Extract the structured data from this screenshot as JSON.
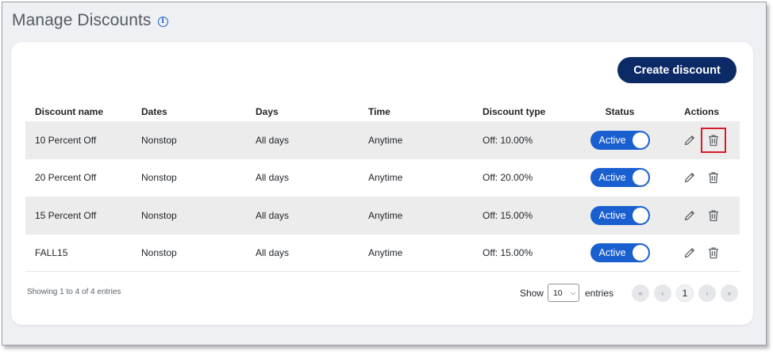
{
  "page": {
    "title": "Manage Discounts",
    "info_icon": "i"
  },
  "toolbar": {
    "create_label": "Create discount"
  },
  "table": {
    "headers": {
      "name": "Discount name",
      "dates": "Dates",
      "days": "Days",
      "time": "Time",
      "type": "Discount type",
      "status": "Status",
      "actions": "Actions"
    },
    "rows": [
      {
        "name": "10 Percent Off",
        "dates": "Nonstop",
        "days": "All days",
        "time": "Anytime",
        "type": "Off: 10.00%",
        "status": "Active"
      },
      {
        "name": "20 Percent Off",
        "dates": "Nonstop",
        "days": "All days",
        "time": "Anytime",
        "type": "Off: 20.00%",
        "status": "Active"
      },
      {
        "name": "15 Percent Off",
        "dates": "Nonstop",
        "days": "All days",
        "time": "Anytime",
        "type": "Off: 15.00%",
        "status": "Active"
      },
      {
        "name": "FALL15",
        "dates": "Nonstop",
        "days": "All days",
        "time": "Anytime",
        "type": "Off: 15.00%",
        "status": "Active"
      }
    ]
  },
  "footer": {
    "info": "Showing 1 to 4 of 4 entries",
    "show_label": "Show",
    "page_size": "10",
    "entries_label": "entries",
    "first": "«",
    "prev": "‹",
    "current_page": "1",
    "next": "›",
    "last": "»"
  },
  "colors": {
    "accent": "#0c2a66",
    "toggle": "#1a5fd0",
    "highlight": "#d41e2a"
  },
  "icons": [
    "info-icon",
    "edit-pencil-icon",
    "trash-icon",
    "chevron-down-icon"
  ]
}
